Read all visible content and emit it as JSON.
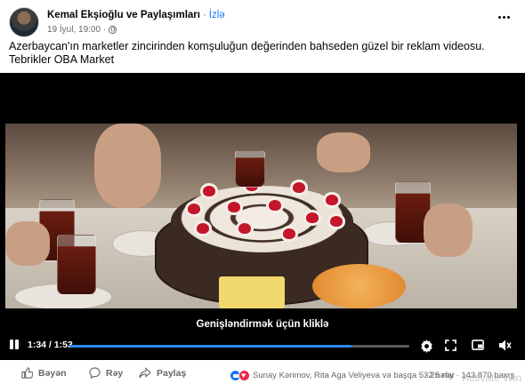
{
  "post": {
    "author": "Kemal Ekşioğlu ve Paylaşımları",
    "separator": "·",
    "follow_label": "İzlə",
    "date": "19 İyul, 19:00",
    "date_separator": "·",
    "caption": "Azerbaycan'ın marketler zincirinden komşuluğun değerinden bahseden güzel bir reklam videosu. Tebrikler OBA Market"
  },
  "video": {
    "expand_label": "Genişləndirmək üçün kliklə",
    "current_time": "1:34",
    "duration": "1:53",
    "time_separator": " / ",
    "progress_fraction": 0.83
  },
  "actions": {
    "like": "Bəyən",
    "comment": "Rəy",
    "share": "Paylaş"
  },
  "engagement": {
    "reactors": "Sunay Kərimov, Rita Aga Veliyeva və başqa 532 nəfər",
    "comments": "25 rəy",
    "views": "143.870 baxış",
    "dot": "·"
  },
  "watermark": "Activate Win",
  "icons": {
    "avatar": "user-avatar",
    "more": "more-options-icon",
    "globe": "public-globe-icon",
    "pause": "pause-icon",
    "settings": "gear-icon",
    "fullscreen": "fullscreen-icon",
    "pip": "picture-in-picture-icon",
    "volume": "volume-icon",
    "like": "thumbs-up-icon",
    "comment": "comment-icon",
    "share": "share-icon"
  },
  "colors": {
    "accent": "#1877f2",
    "progress": "#2d88ff",
    "meta_text": "#65676b"
  }
}
